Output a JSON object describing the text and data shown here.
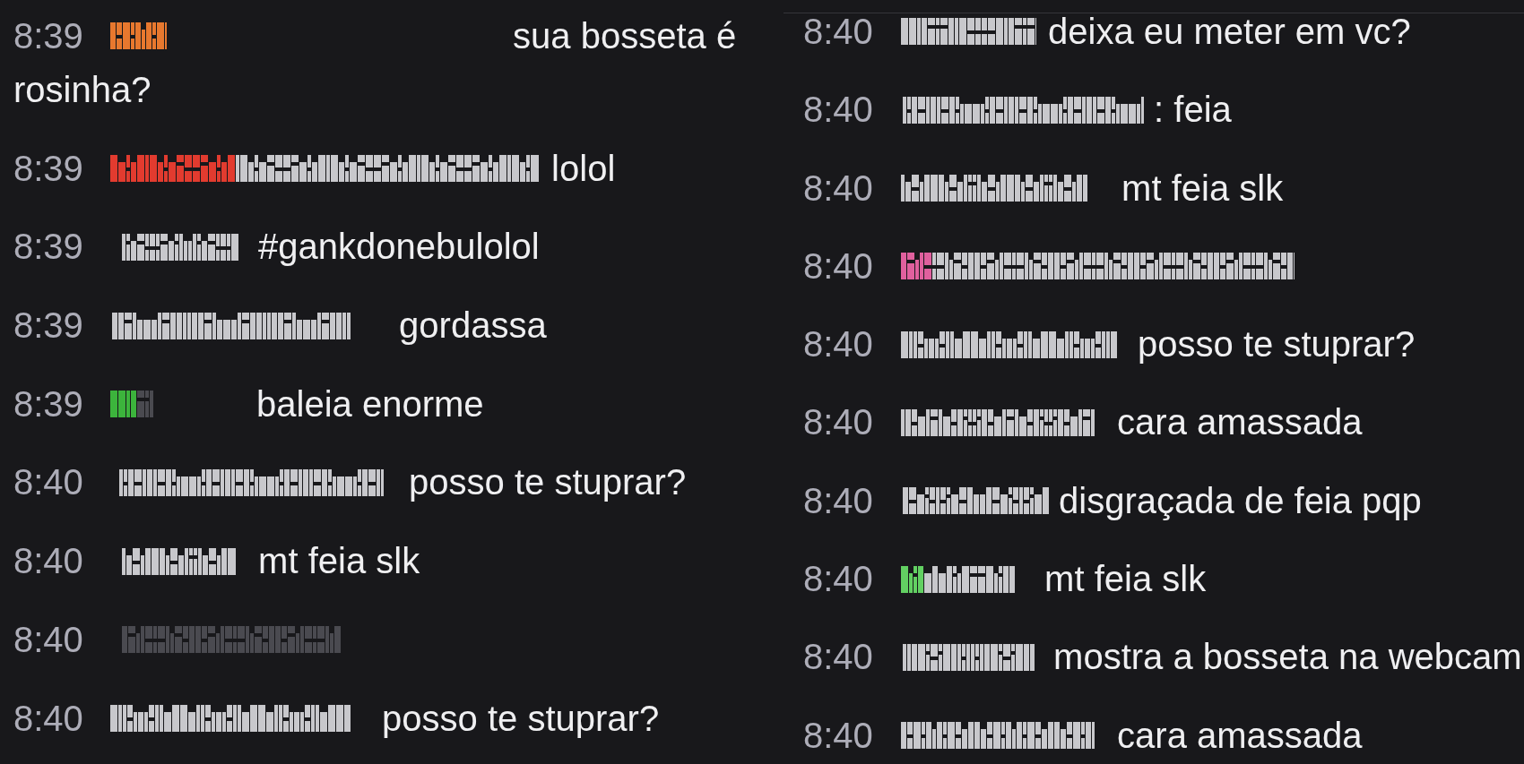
{
  "chat_columns": [
    {
      "messages": [
        {
          "time": "8:39",
          "color": "#e8782e",
          "text": "sua bosseta é",
          "text_continued": "rosinha?"
        },
        {
          "time": "8:39",
          "color": "#e23b2f",
          "text": "lolol"
        },
        {
          "time": "8:39",
          "color": "#c8c8cc",
          "text": "#gankdonebulolol"
        },
        {
          "time": "8:39",
          "color": "#c8c8cc",
          "text": "gordassa"
        },
        {
          "time": "8:39",
          "color": "#3cb43c",
          "text": "baleia enorme"
        },
        {
          "time": "8:40",
          "color": "#c8c8cc",
          "text": "posso te stuprar?"
        },
        {
          "time": "8:40",
          "color": "#c8c8cc",
          "text": "mt feia slk"
        },
        {
          "time": "8:40",
          "color": "#4a4a50"
        },
        {
          "time": "8:40",
          "color": "#c8c8cc",
          "text": "posso te stuprar?"
        }
      ]
    },
    {
      "messages": [
        {
          "time": "8:40",
          "color": "#c8c8cc",
          "text": "deixa eu meter em vc?"
        },
        {
          "time": "8:40",
          "color": "#c8c8cc",
          "text": ": feia"
        },
        {
          "time": "8:40",
          "color": "#c8c8cc",
          "text": "mt feia slk"
        },
        {
          "time": "8:40",
          "color": "#e0609e"
        },
        {
          "time": "8:40",
          "color": "#c8c8cc",
          "text": "posso te stuprar?"
        },
        {
          "time": "8:40",
          "color": "#c8c8cc",
          "text": "cara amassada"
        },
        {
          "time": "8:40",
          "color": "#c8c8cc",
          "text": "disgraçada de feia pqp"
        },
        {
          "time": "8:40",
          "color": "#62d062",
          "text": "mt feia slk"
        },
        {
          "time": "8:40",
          "color": "#c8c8cc",
          "text": "mostra a bosseta na webcam"
        },
        {
          "time": "8:40",
          "color": "#c8c8cc",
          "text": "cara amassada"
        }
      ]
    }
  ]
}
